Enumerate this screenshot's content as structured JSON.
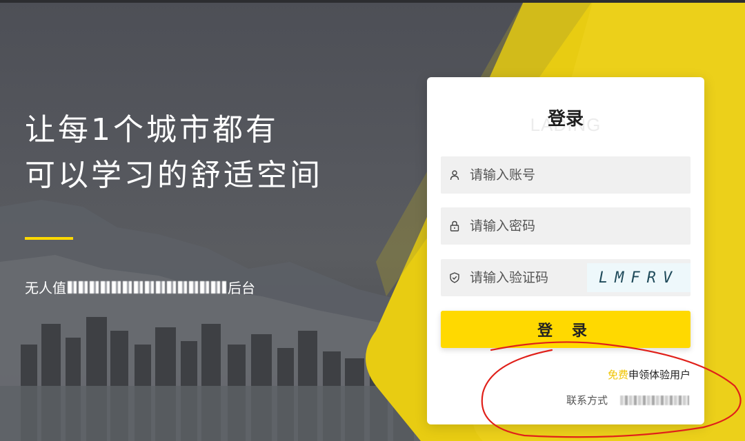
{
  "hero": {
    "headline_line1": "让每1个城市都有",
    "headline_line2": "可以学习的舒适空间",
    "subtitle_prefix": "无人值",
    "subtitle_suffix": "后台"
  },
  "login": {
    "title": "登录",
    "watermark": "LADING",
    "username_placeholder": "请输入账号",
    "password_placeholder": "请输入密码",
    "captcha_placeholder": "请输入验证码",
    "captcha_text": "LMFRV",
    "submit_label": "登 录",
    "trial_highlight": "免费",
    "trial_text": "申领体验用户",
    "contact_label": "联系方式"
  },
  "icons": {
    "username": "user-icon",
    "password": "lock-icon",
    "captcha": "shield-icon"
  },
  "colors": {
    "accent_yellow": "#ffd900",
    "band_yellow": "#e8cc12",
    "annotation_red": "#e0201a"
  }
}
